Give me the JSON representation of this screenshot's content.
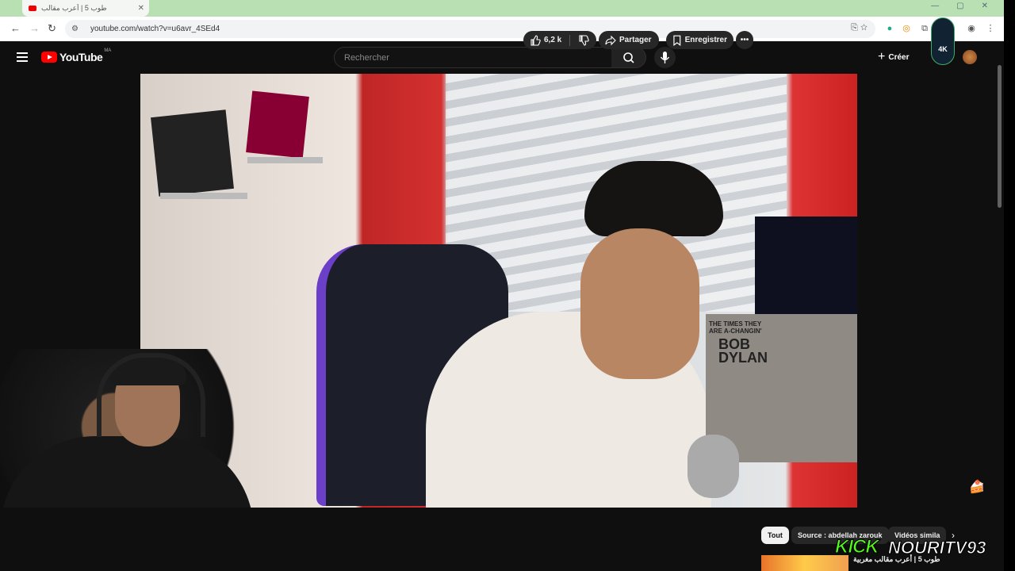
{
  "browser": {
    "tab_title": "طوب 5 | أعرب مقالب",
    "url": "youtube.com/watch?v=u6avr_4SEd4"
  },
  "header": {
    "logo_text": "YouTube",
    "country_code": "MA",
    "search_placeholder": "Rechercher",
    "create_label": "Créer",
    "badge_text": "4K"
  },
  "video": {
    "album_top": "THE TIMES THEY ARE A-CHANGIN'",
    "album_artist_1": "BOB",
    "album_artist_2": "DYLAN"
  },
  "actions": {
    "likes": "6,2 k",
    "share_label": "Partager",
    "save_label": "Enregistrer"
  },
  "chips": [
    "Tout",
    "Source : abdellah zarouk",
    "Vidéos simila"
  ],
  "recommended": {
    "title": "طوب 5 | أعرب مقالب مغربية"
  },
  "overlay": {
    "kick": "KICK",
    "channel": "NOURITV93"
  },
  "colors": {
    "yt_red": "#ff0000",
    "kick_green": "#53fc18",
    "bg": "#0f0f0f"
  }
}
